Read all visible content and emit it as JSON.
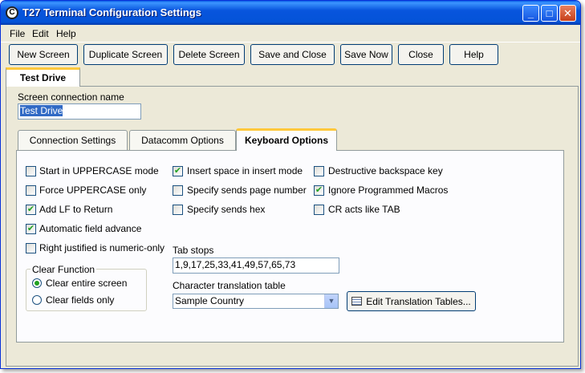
{
  "window": {
    "title": "T27 Terminal Configuration Settings",
    "controls": {
      "minimize": "_",
      "maximize": "□",
      "close": "✕"
    }
  },
  "menu": [
    "File",
    "Edit",
    "Help"
  ],
  "toolbar": {
    "new_screen": "New Screen",
    "duplicate_screen": "Duplicate Screen",
    "delete_screen": "Delete Screen",
    "save_and_close": "Save and Close",
    "save_now": "Save Now",
    "close": "Close",
    "help": "Help"
  },
  "screen_tab": {
    "label": "Test Drive"
  },
  "connection_name": {
    "label": "Screen connection name",
    "value": "Test Drive"
  },
  "subtabs": [
    "Connection Settings",
    "Datacomm Options",
    "Keyboard Options"
  ],
  "active_subtab": "Keyboard Options",
  "checkboxes": [
    {
      "label": "Start in UPPERCASE mode",
      "checked": false
    },
    {
      "label": "Force UPPERCASE only",
      "checked": false
    },
    {
      "label": "Add LF to Return",
      "checked": true
    },
    {
      "label": "Automatic field advance",
      "checked": true
    },
    {
      "label": "Right justified is numeric-only",
      "checked": false
    },
    {
      "label": "Insert space in insert mode",
      "checked": true
    },
    {
      "label": "Specify sends page number",
      "checked": false
    },
    {
      "label": "Specify sends hex",
      "checked": false
    },
    {
      "label": "Destructive backspace key",
      "checked": false
    },
    {
      "label": "Ignore Programmed Macros",
      "checked": true
    },
    {
      "label": "CR acts like TAB",
      "checked": false
    }
  ],
  "clear_function": {
    "label": "Clear Function",
    "options": [
      {
        "label": "Clear entire screen",
        "selected": true
      },
      {
        "label": "Clear fields only",
        "selected": false
      }
    ]
  },
  "tab_stops": {
    "label": "Tab stops",
    "value": "1,9,17,25,33,41,49,57,65,73"
  },
  "translation": {
    "label": "Character translation table",
    "selected": "Sample Country",
    "edit_button": "Edit Translation Tables..."
  },
  "icons": {
    "app": "terminal-app-icon",
    "dropdown": "chevron-down-icon",
    "table": "table-icon"
  },
  "colors": {
    "titlebar": "#0855DD",
    "face": "#ECE9D8",
    "tab_accent": "#FFC83C",
    "check": "#21A121"
  }
}
